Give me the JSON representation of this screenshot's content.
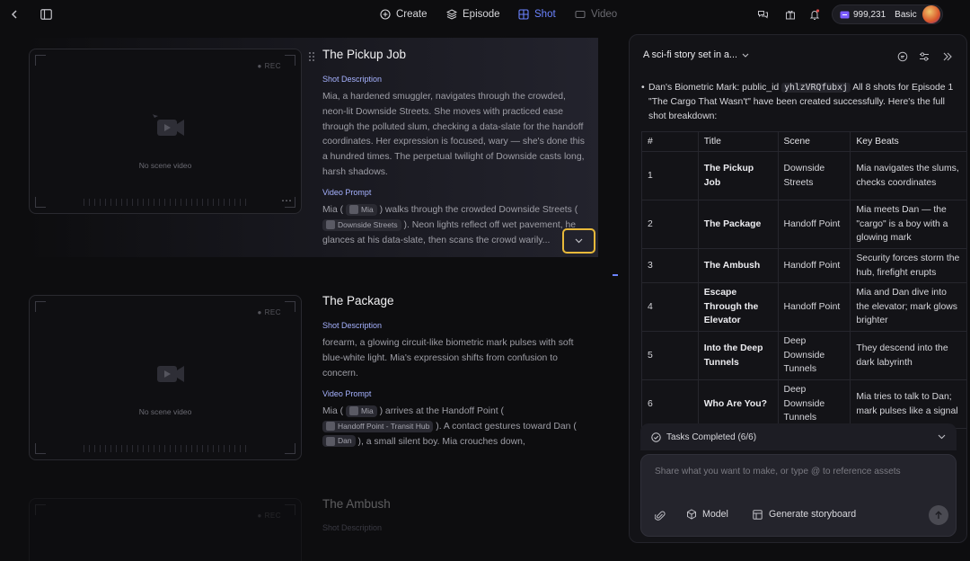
{
  "nav": {
    "items": [
      {
        "label": "Create"
      },
      {
        "label": "Episode"
      },
      {
        "label": "Shot"
      },
      {
        "label": "Video"
      }
    ],
    "credits": "999,231",
    "plan": "Basic"
  },
  "shots": [
    {
      "title": "The Pickup Job",
      "rec": "REC",
      "no_video": "No scene video",
      "desc_label": "Shot Description",
      "description": "Mia, a hardened smuggler, navigates through the crowded, neon-lit Downside Streets. She moves with practiced ease through the polluted slum, checking a data-slate for the handoff coordinates. Her expression is focused, wary — she's done this a hundred times. The perpetual twilight of Downside casts long, harsh shadows.",
      "prompt_label": "Video Prompt",
      "prompt_a": "Mia (",
      "chip1": "Mia",
      "prompt_b": ") walks through the crowded Downside Streets (",
      "chip2": "Downside Streets",
      "prompt_c": "). Neon lights reflect off wet pavement, he glances at his data-slate, then scans the crowd warily..."
    },
    {
      "title": "The Package",
      "rec": "REC",
      "no_video": "No scene video",
      "desc_label": "Shot Description",
      "description": "forearm, a glowing circuit-like biometric mark pulses with soft blue-white light. Mia's expression shifts from confusion to concern.",
      "prompt_label": "Video Prompt",
      "prompt_a": "Mia (",
      "chip1": "Mia",
      "prompt_b": ") arrives at the Handoff Point (",
      "chip2": "Handoff Point - Transit Hub",
      "prompt_c": "). A contact gestures toward Dan (",
      "chip3": "Dan",
      "prompt_d": "), a small silent boy. Mia crouches down,"
    },
    {
      "title": "The Ambush",
      "rec": "REC",
      "desc_label": "Shot Description"
    }
  ],
  "panel": {
    "title": "A sci-fi story set in a...",
    "intro_a": "Dan's Biometric Mark: public_id ",
    "intro_code": "yhlzVRQfubxj",
    "intro_b": " All 8 shots for Episode 1 \"The Cargo That Wasn't\" have been created successfully. Here's the full shot breakdown:",
    "table": {
      "headers": [
        "#",
        "Title",
        "Scene",
        "Key Beats"
      ],
      "rows": [
        [
          "1",
          "The Pickup Job",
          "Downside Streets",
          "Mia navigates the slums, checks coordinates"
        ],
        [
          "2",
          "The Package",
          "Handoff Point",
          "Mia meets Dan — the \"cargo\" is a boy with a glowing mark"
        ],
        [
          "3",
          "The Ambush",
          "Handoff Point",
          "Security forces storm the hub, firefight erupts"
        ],
        [
          "4",
          "Escape Through the Elevator",
          "Handoff Point",
          "Mia and Dan dive into the elevator; mark glows brighter"
        ],
        [
          "5",
          "Into the Deep Tunnels",
          "Deep Downside Tunnels",
          "They descend into the dark labyrinth"
        ],
        [
          "6",
          "Who Are You?",
          "Deep Downside Tunnels",
          "Mia tries to talk to Dan; mark pulses like a signal"
        ]
      ]
    },
    "tasks": "Tasks Completed (6/6)",
    "composer_placeholder": "Share what you want to make, or type @ to reference assets",
    "model_label": "Model",
    "storyboard_label": "Generate storyboard"
  },
  "colors": {
    "accent": "#6b83ff",
    "highlight_border": "#e8b93a"
  }
}
